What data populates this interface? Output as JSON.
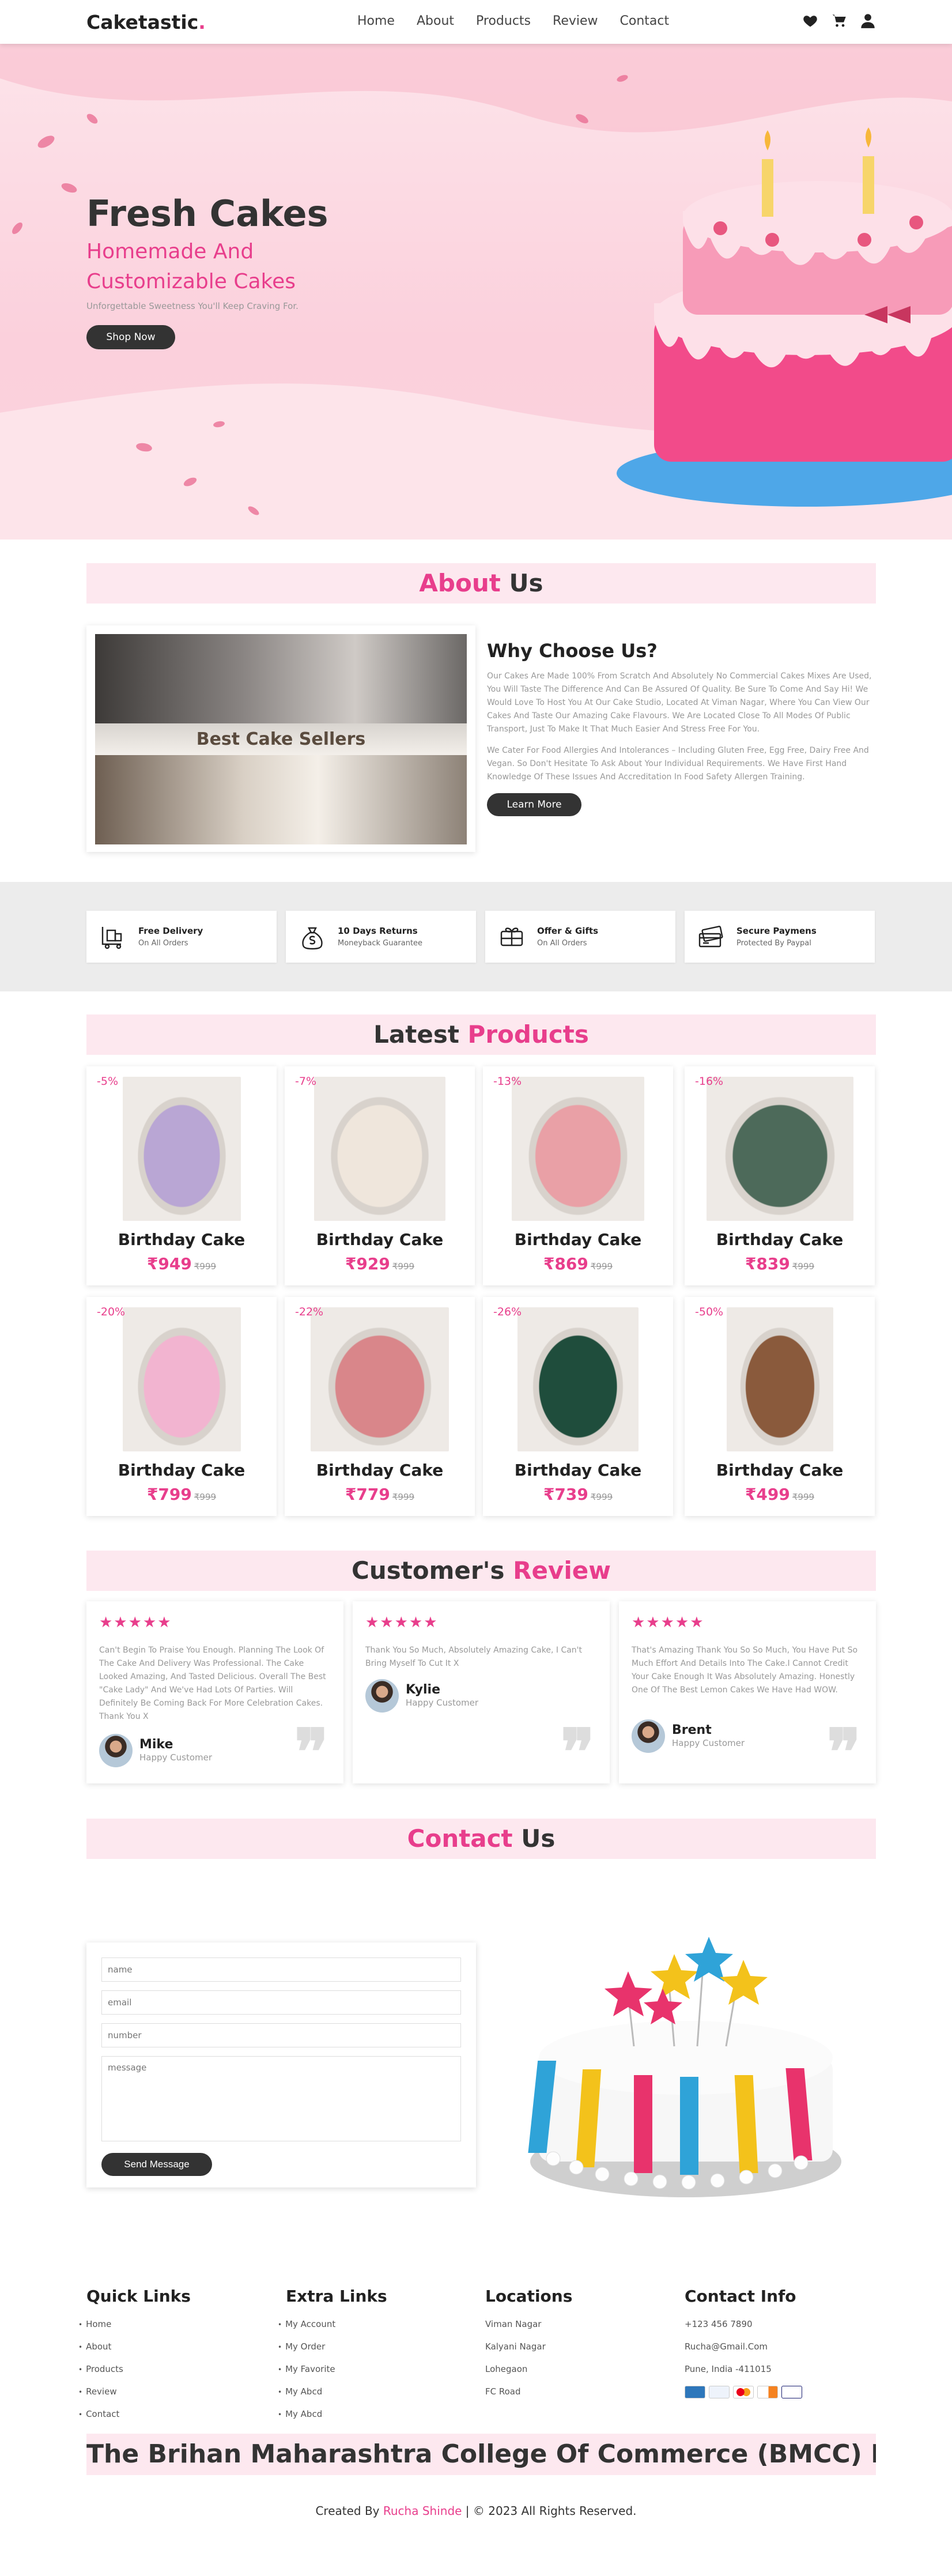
{
  "header": {
    "logo": "Caketastic",
    "logo_dot": ".",
    "nav": [
      "Home",
      "About",
      "Products",
      "Review",
      "Contact"
    ]
  },
  "hero": {
    "title": "Fresh Cakes",
    "subtitle": "Homemade And Customizable Cakes",
    "tagline": "Unforgettable Sweetness You'll Keep Craving For.",
    "button": "Shop Now"
  },
  "about": {
    "heading_highlight": "About",
    "heading_rest": " Us",
    "caption": "Best Cake Sellers",
    "title": "Why Choose Us?",
    "para1": "Our Cakes Are Made 100% From Scratch And Absolutely No Commercial Cakes Mixes Are Used, You Will Taste The Difference And Can Be Assured Of Quality. Be Sure To Come And Say Hi! We Would Love To Host You At Our Cake Studio, Located At Viman Nagar, Where You Can View Our Cakes And Taste Our Amazing Cake Flavours. We Are Located Close To All Modes Of Public Transport, Just To Make It That Much Easier And Stress Free For You.",
    "para2": "We Cater For Food Allergies And Intolerances – Including Gluten Free, Egg Free, Dairy Free And Vegan. So Don't Hesitate To Ask About Your Individual Requirements. We Have First Hand Knowledge Of These Issues And Accreditation In Food Safety Allergen Training.",
    "button": "Learn More"
  },
  "features": [
    {
      "title": "Free Delivery",
      "sub": "On All Orders",
      "icon": "trolley-icon"
    },
    {
      "title": "10 Days Returns",
      "sub": "Moneyback Guarantee",
      "icon": "money-bag-icon"
    },
    {
      "title": "Offer & Gifts",
      "sub": "On All Orders",
      "icon": "gift-icon"
    },
    {
      "title": "Secure Paymens",
      "sub": "Protected By Paypal",
      "icon": "credit-card-icon"
    }
  ],
  "products": {
    "heading_lead": "Latest ",
    "heading_highlight": "Products",
    "items": [
      {
        "discount": "-5%",
        "name": "Birthday Cake",
        "price": "₹949",
        "old": "₹999",
        "color": "#b9a6d4"
      },
      {
        "discount": "-7%",
        "name": "Birthday Cake",
        "price": "₹929",
        "old": "₹999",
        "color": "#efe6dc"
      },
      {
        "discount": "-13%",
        "name": "Birthday Cake",
        "price": "₹869",
        "old": "₹999",
        "color": "#e9a0a6"
      },
      {
        "discount": "-16%",
        "name": "Birthday Cake",
        "price": "₹839",
        "old": "₹999",
        "color": "#4d6a5a"
      },
      {
        "discount": "-20%",
        "name": "Birthday Cake",
        "price": "₹799",
        "old": "₹999",
        "color": "#f2b4d0"
      },
      {
        "discount": "-22%",
        "name": "Birthday Cake",
        "price": "₹779",
        "old": "₹999",
        "color": "#d9868a"
      },
      {
        "discount": "-26%",
        "name": "Birthday Cake",
        "price": "₹739",
        "old": "₹999",
        "color": "#1f4d3c"
      },
      {
        "discount": "-50%",
        "name": "Birthday Cake",
        "price": "₹499",
        "old": "₹999",
        "color": "#8a5a3c"
      }
    ]
  },
  "reviews": {
    "heading_lead": "Customer's ",
    "heading_highlight": "Review",
    "stars": "★★★★★",
    "quote": "❞",
    "items": [
      {
        "text": "Can't Begin To Praise You Enough. Planning The Look Of The Cake And Delivery Was Professional. The Cake Looked Amazing, And Tasted Delicious. Overall The Best \"Cake Lady\" And We've Had Lots Of Parties. Will Definitely Be Coming Back For More Celebration Cakes. Thank You X",
        "name": "Mike",
        "role": "Happy Customer"
      },
      {
        "text": "Thank You So Much, Absolutely Amazing Cake, I Can't Bring Myself To Cut It X",
        "name": "Kylie",
        "role": "Happy Customer"
      },
      {
        "text": "That's Amazing Thank You So So Much, You Have Put So Much Effort And Details Into The Cake.I Cannot Credit Your Cake Enough It Was Absolutely Amazing. Honestly One Of The Best Lemon Cakes We Have Had WOW.",
        "name": "Brent",
        "role": "Happy Customer"
      }
    ]
  },
  "contact": {
    "heading_highlight": "Contact",
    "heading_rest": " Us",
    "placeholders": {
      "name": "name",
      "email": "email",
      "number": "number",
      "message": "message"
    },
    "button": "Send Message"
  },
  "footer": {
    "quick": {
      "title": "Quick Links",
      "links": [
        "Home",
        "About",
        "Products",
        "Review",
        "Contact"
      ]
    },
    "extra": {
      "title": "Extra Links",
      "links": [
        "My Account",
        "My Order",
        "My Favorite",
        "My Abcd",
        "My Abcd"
      ]
    },
    "locations": {
      "title": "Locations",
      "links": [
        "Viman Nagar",
        "Kalyani Nagar",
        "Lohegaon",
        "FC Road"
      ]
    },
    "contact": {
      "title": "Contact Info",
      "links": [
        "+123 456 7890",
        "Rucha@Gmail.Com",
        "Pune, India -411015"
      ]
    },
    "payment_brands": [
      "amex",
      "paypal",
      "mastercard",
      "discover",
      "visa"
    ],
    "marquee": "The Brihan Maharashtra College Of Commerce (BMCC) Is A P",
    "credit_prefix": "Created By ",
    "credit_name": "Rucha Shinde",
    "credit_suffix": " | © 2023 All Rights Reserved."
  },
  "colors": {
    "accent": "#e83e8c",
    "dark": "#333333",
    "pink_bg": "#fde8ef"
  }
}
